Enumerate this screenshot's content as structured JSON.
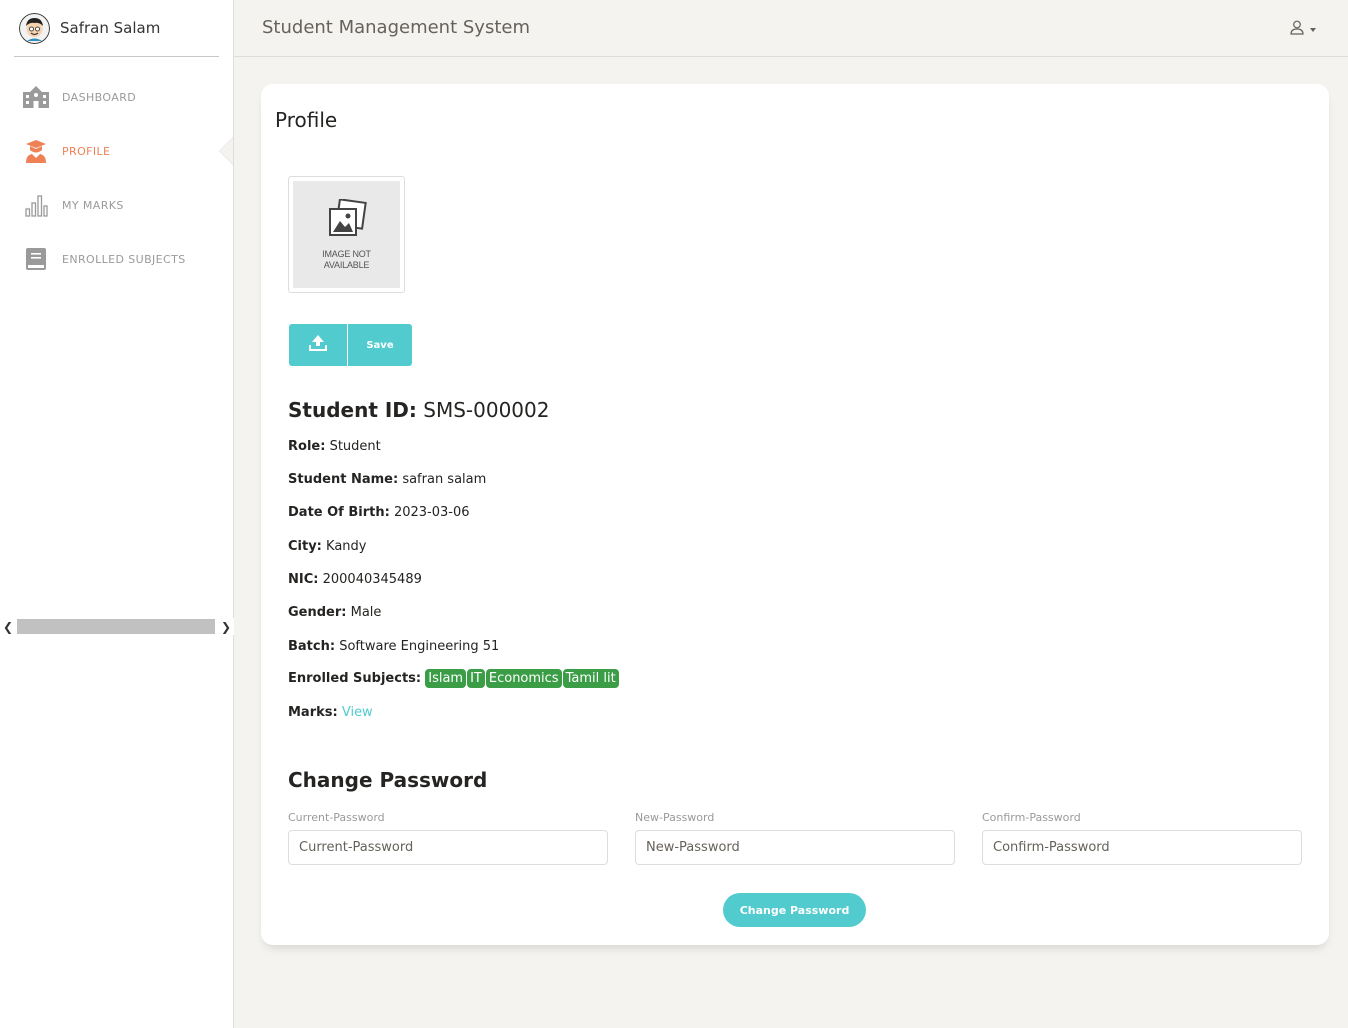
{
  "app": {
    "title": "Student Management System"
  },
  "sidebar": {
    "user_name": "Safran Salam",
    "items": [
      {
        "label": "DASHBOARD",
        "icon": "school-building-icon",
        "active": false
      },
      {
        "label": "PROFILE",
        "icon": "graduate-student-icon",
        "active": true
      },
      {
        "label": "MY MARKS",
        "icon": "bar-chart-icon",
        "active": false
      },
      {
        "label": "ENROLLED SUBJECTS",
        "icon": "book-icon",
        "active": false
      }
    ]
  },
  "profile": {
    "title": "Profile",
    "image_placeholder_line1": "IMAGE NOT",
    "image_placeholder_line2": "AVAILABLE",
    "save_label": "Save",
    "student_id_label": "Student ID:",
    "student_id": "SMS-000002",
    "fields": {
      "role_label": "Role:",
      "role": "Student",
      "name_label": "Student Name:",
      "name": "safran salam",
      "dob_label": "Date Of Birth:",
      "dob": "2023-03-06",
      "city_label": "City:",
      "city": "Kandy",
      "nic_label": "NIC:",
      "nic": "200040345489",
      "gender_label": "Gender:",
      "gender": "Male",
      "batch_label": "Batch:",
      "batch": "Software Engineering 51",
      "subjects_label": "Enrolled Subjects:",
      "subjects": [
        "Islam",
        "IT",
        "Economics",
        "Tamil lit"
      ],
      "marks_label": "Marks:",
      "marks_link": "View"
    }
  },
  "change_password": {
    "title": "Change Password",
    "current_label": "Current-Password",
    "current_placeholder": "Current-Password",
    "new_label": "New-Password",
    "new_placeholder": "New-Password",
    "confirm_label": "Confirm-Password",
    "confirm_placeholder": "Confirm-Password",
    "button_label": "Change Password"
  },
  "colors": {
    "accent": "#51cbce",
    "active_nav": "#ef8157",
    "badge": "#3b9e47"
  }
}
